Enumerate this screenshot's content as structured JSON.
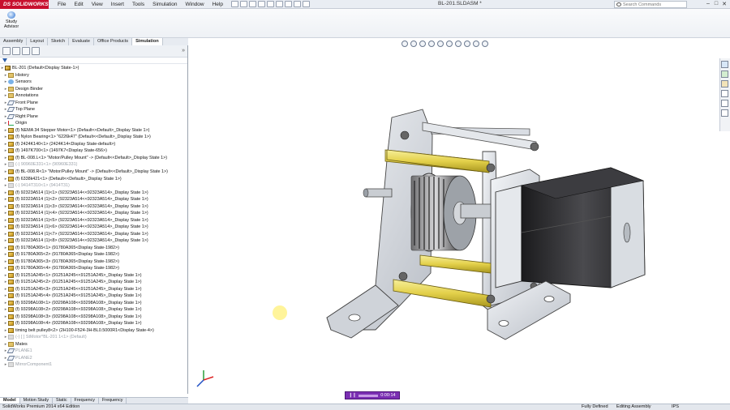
{
  "app": {
    "logo_text": "DS SOLIDWORKS",
    "document_title": "BL-201.SLDASM *"
  },
  "menus": [
    "File",
    "Edit",
    "View",
    "Insert",
    "Tools",
    "Simulation",
    "Window",
    "Help"
  ],
  "search": {
    "placeholder": "Search Commands"
  },
  "window_controls": {
    "minimize": "–",
    "restore": "□",
    "close": "✕"
  },
  "command_manager": {
    "study_advisor_label": "Study Advisor",
    "tabs": [
      {
        "label": "Assembly",
        "active": false
      },
      {
        "label": "Layout",
        "active": false
      },
      {
        "label": "Sketch",
        "active": false
      },
      {
        "label": "Evaluate",
        "active": false
      },
      {
        "label": "Office Products",
        "active": false
      },
      {
        "label": "Simulation",
        "active": true
      }
    ]
  },
  "panel": {
    "collapse_glyph": "»"
  },
  "tree": [
    {
      "label": "BL-201  (Default<Display State-1>)",
      "icon": "asm",
      "level": 0,
      "grey": false
    },
    {
      "label": "History",
      "icon": "folder",
      "level": 1,
      "grey": false
    },
    {
      "label": "Sensors",
      "icon": "sensor",
      "level": 1,
      "grey": false
    },
    {
      "label": "Design Binder",
      "icon": "folder",
      "level": 1,
      "grey": false
    },
    {
      "label": "Annotations",
      "icon": "folder",
      "level": 1,
      "grey": false
    },
    {
      "label": "Front Plane",
      "icon": "plane",
      "level": 1,
      "grey": false
    },
    {
      "label": "Top Plane",
      "icon": "plane",
      "level": 1,
      "grey": false
    },
    {
      "label": "Right Plane",
      "icon": "plane",
      "level": 1,
      "grey": false
    },
    {
      "label": "Origin",
      "icon": "origin",
      "level": 1,
      "grey": false
    },
    {
      "label": "(f) NEMA 34 Stepper Motor<1> (Default<<Default>_Display State 1>)",
      "icon": "part",
      "level": 1,
      "grey": false
    },
    {
      "label": "(f) Nylon Bearing<1> \"6226k47\" (Default<<Default>_Display State 1>)",
      "icon": "part",
      "level": 1,
      "grey": false
    },
    {
      "label": "(f) 2424K140<1> (2424K14<Display State-default>)",
      "icon": "part",
      "level": 1,
      "grey": false
    },
    {
      "label": "(f) 1497K700<1> (1497K7<Display State-656>)",
      "icon": "part",
      "level": 1,
      "grey": false
    },
    {
      "label": "(f) BL-008.L<1> \"Motor/Pulley Mount\" -> (Default<<Default>_Display State 1>)",
      "icon": "part",
      "level": 1,
      "grey": false
    },
    {
      "label": "(-) 90960E331<1> (90960E331)",
      "icon": "dim",
      "level": 1,
      "grey": true
    },
    {
      "label": "(f) BL-008.R<1> \"Motor/Pulley Mount\" -> (Default<<Default>_Display State 1>)",
      "icon": "part",
      "level": 1,
      "grey": false
    },
    {
      "label": "(f) 6338k421<1> (Default<<Default>_Display State 1>)",
      "icon": "part",
      "level": 1,
      "grey": false
    },
    {
      "label": "(-) 9414T310<1> (9414T31)",
      "icon": "dim",
      "level": 1,
      "grey": true
    },
    {
      "label": "(f) 92323A514 (1)<1> (92323A514<<92323A514>_Display State 1>)",
      "icon": "part",
      "level": 1,
      "grey": false
    },
    {
      "label": "(f) 92323A514 (1)<2> (92323A514<<92323A514>_Display State 1>)",
      "icon": "part",
      "level": 1,
      "grey": false
    },
    {
      "label": "(f) 92323A514 (1)<3> (92323A514<<92323A514>_Display State 1>)",
      "icon": "part",
      "level": 1,
      "grey": false
    },
    {
      "label": "(f) 92323A514 (1)<4> (92323A514<<92323A514>_Display State 1>)",
      "icon": "part",
      "level": 1,
      "grey": false
    },
    {
      "label": "(f) 92323A514 (1)<5> (92323A514<<92323A514>_Display State 1>)",
      "icon": "part",
      "level": 1,
      "grey": false
    },
    {
      "label": "(f) 92323A514 (1)<6> (92323A514<<92323A514>_Display State 1>)",
      "icon": "part",
      "level": 1,
      "grey": false
    },
    {
      "label": "(f) 92323A514 (1)<7> (92323A514<<92323A514>_Display State 1>)",
      "icon": "part",
      "level": 1,
      "grey": false
    },
    {
      "label": "(f) 92323A514 (1)<8> (92323A514<<92323A514>_Display State 1>)",
      "icon": "part",
      "level": 1,
      "grey": false
    },
    {
      "label": "(f) 91780A365<1> (91780A365<Display State-1982>)",
      "icon": "part",
      "level": 1,
      "grey": false
    },
    {
      "label": "(f) 91780A365<2> (91780A365<Display State-1982>)",
      "icon": "part",
      "level": 1,
      "grey": false
    },
    {
      "label": "(f) 91780A365<3> (91780A365<Display State-1982>)",
      "icon": "part",
      "level": 1,
      "grey": false
    },
    {
      "label": "(f) 91780A365<4> (91780A365<Display State-1982>)",
      "icon": "part",
      "level": 1,
      "grey": false
    },
    {
      "label": "(f) 91251A245<1> (91251A245<<91251A245>_Display State 1>)",
      "icon": "part",
      "level": 1,
      "grey": false
    },
    {
      "label": "(f) 91251A245<2> (91251A245<<91251A245>_Display State 1>)",
      "icon": "part",
      "level": 1,
      "grey": false
    },
    {
      "label": "(f) 91251A245<3> (91251A245<<91251A245>_Display State 1>)",
      "icon": "part",
      "level": 1,
      "grey": false
    },
    {
      "label": "(f) 91251A245<4> (91251A245<<91251A245>_Display State 1>)",
      "icon": "part",
      "level": 1,
      "grey": false
    },
    {
      "label": "(f) 93298A108<1> (93298A108<<93298A108>_Display State 1>)",
      "icon": "part",
      "level": 1,
      "grey": false
    },
    {
      "label": "(f) 93298A108<2> (93298A108<<93298A108>_Display State 1>)",
      "icon": "part",
      "level": 1,
      "grey": false
    },
    {
      "label": "(f) 93298A108<3> (93298A108<<93298A108>_Display State 1>)",
      "icon": "part",
      "level": 1,
      "grey": false
    },
    {
      "label": "(f) 93298A108<4> (93298A108<<93298A108>_Display State 1>)",
      "icon": "part",
      "level": 1,
      "grey": false
    },
    {
      "label": "timing belt pulley8<2> (2H100-F524-3H-BL0.5000R1<Display State-4>)",
      "icon": "part",
      "level": 1,
      "grey": false
    },
    {
      "label": "(-) [ ] StMotor^BL-201 1<1> (Default)",
      "icon": "dim",
      "level": 1,
      "grey": true
    },
    {
      "label": "Mates",
      "icon": "folder",
      "level": 1,
      "grey": false
    },
    {
      "label": "PLANE1",
      "icon": "plane",
      "level": 1,
      "grey": true
    },
    {
      "label": "PLANE2",
      "icon": "plane",
      "level": 1,
      "grey": true
    },
    {
      "label": "MirrorComponent1",
      "icon": "dim",
      "level": 1,
      "grey": true
    }
  ],
  "bottom_tabs": [
    {
      "label": "Model",
      "active": true
    },
    {
      "label": "Motion Study",
      "active": false
    },
    {
      "label": "Static",
      "active": false
    },
    {
      "label": "Frequency",
      "active": false
    },
    {
      "label": "Frequency",
      "active": false
    }
  ],
  "player": {
    "time": "0:00:14",
    "pause_glyph": "❙❙"
  },
  "status": {
    "edition": "SolidWorks Premium 2014 x64 Edition",
    "definition": "Fully Defined",
    "mode": "Editing Assembly",
    "units": "IPS"
  },
  "colors": {
    "spacer": "#e7da55",
    "sheet_metal": "#cfd3d9",
    "motor_body": "#2c2c2e",
    "accent": "#c8102e"
  }
}
